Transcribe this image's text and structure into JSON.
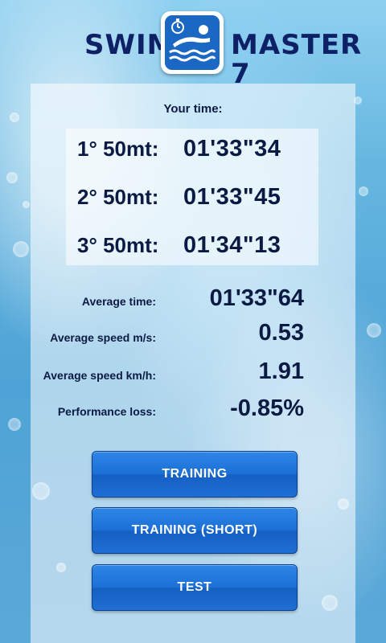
{
  "header": {
    "title_left": "SWIM",
    "title_right": "MASTER 7",
    "logo_icon": "swimmer-stopwatch-icon"
  },
  "results": {
    "your_time_label": "Your time:",
    "laps": [
      {
        "label": "1° 50mt:",
        "time": "01'33\"34"
      },
      {
        "label": "2° 50mt:",
        "time": "01'33\"45"
      },
      {
        "label": "3° 50mt:",
        "time": "01'34\"13"
      }
    ],
    "stats": [
      {
        "label": "Average time:",
        "value": "01'33\"64"
      },
      {
        "label": "Average speed m/s:",
        "value": "0.53"
      },
      {
        "label": "Average speed km/h:",
        "value": "1.91"
      },
      {
        "label": "Performance loss:",
        "value": "-0.85%"
      }
    ]
  },
  "buttons": {
    "training": "TRAINING",
    "training_short": "TRAINING (SHORT)",
    "test": "TEST"
  },
  "colors": {
    "button": "#1b6fd6",
    "title": "#0e2166",
    "logo": "#1a67c4"
  }
}
